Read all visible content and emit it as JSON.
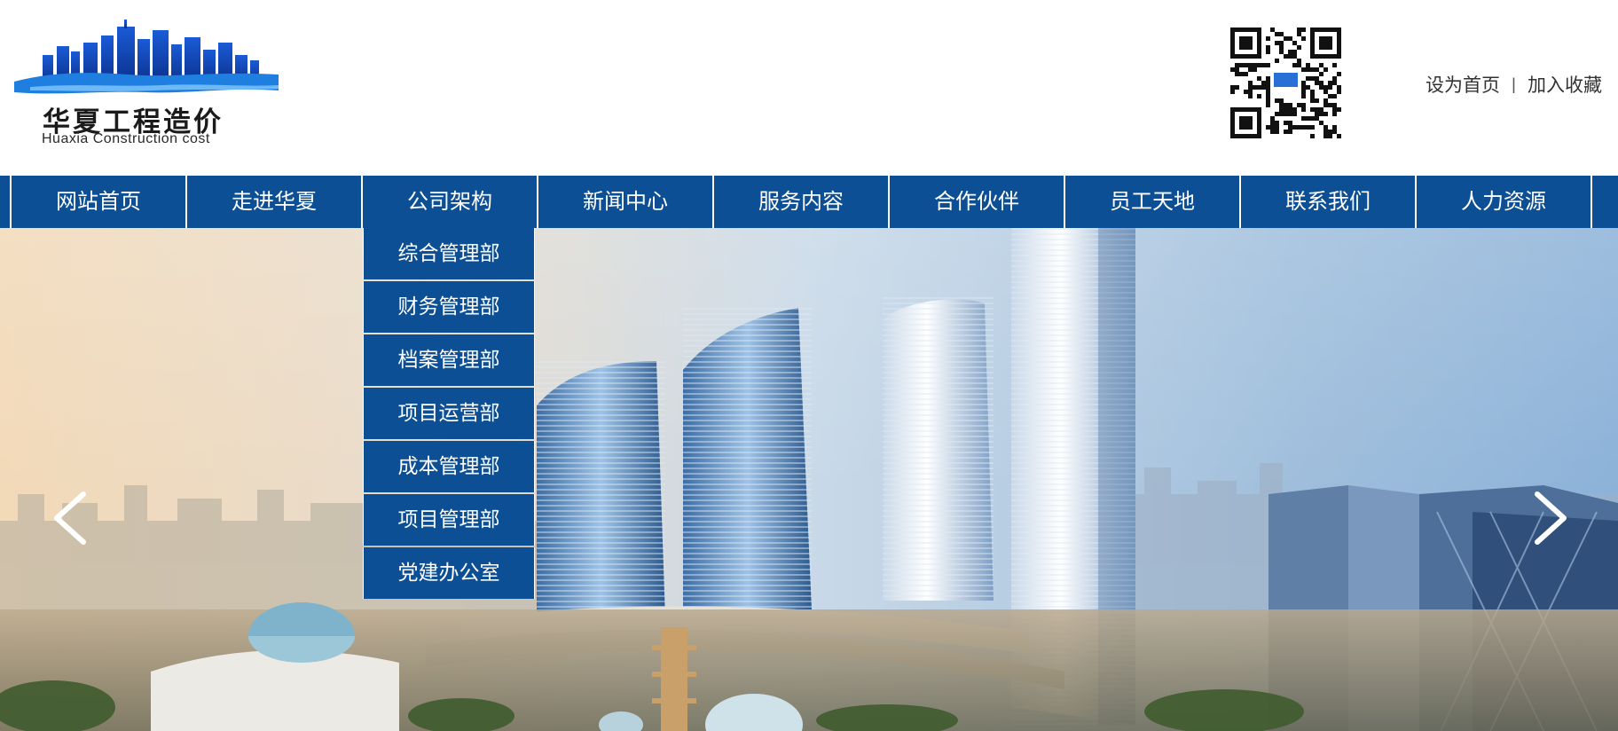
{
  "header": {
    "logo_cn": "华夏工程造价",
    "logo_en": "Huaxia Construction cost",
    "links": [
      "设为首页",
      "加入收藏"
    ],
    "link_separator": "丨"
  },
  "nav": {
    "items": [
      "网站首页",
      "走进华夏",
      "公司架构",
      "新闻中心",
      "服务内容",
      "合作伙伴",
      "员工天地",
      "联系我们",
      "人力资源"
    ],
    "active_index": 2,
    "color": "#0d4f94"
  },
  "dropdown": {
    "items": [
      "综合管理部",
      "财务管理部",
      "档案管理部",
      "项目运营部",
      "成本管理部",
      "项目管理部",
      "党建办公室"
    ]
  },
  "carousel": {
    "prev_icon": "chevron-left-icon",
    "next_icon": "chevron-right-icon"
  }
}
